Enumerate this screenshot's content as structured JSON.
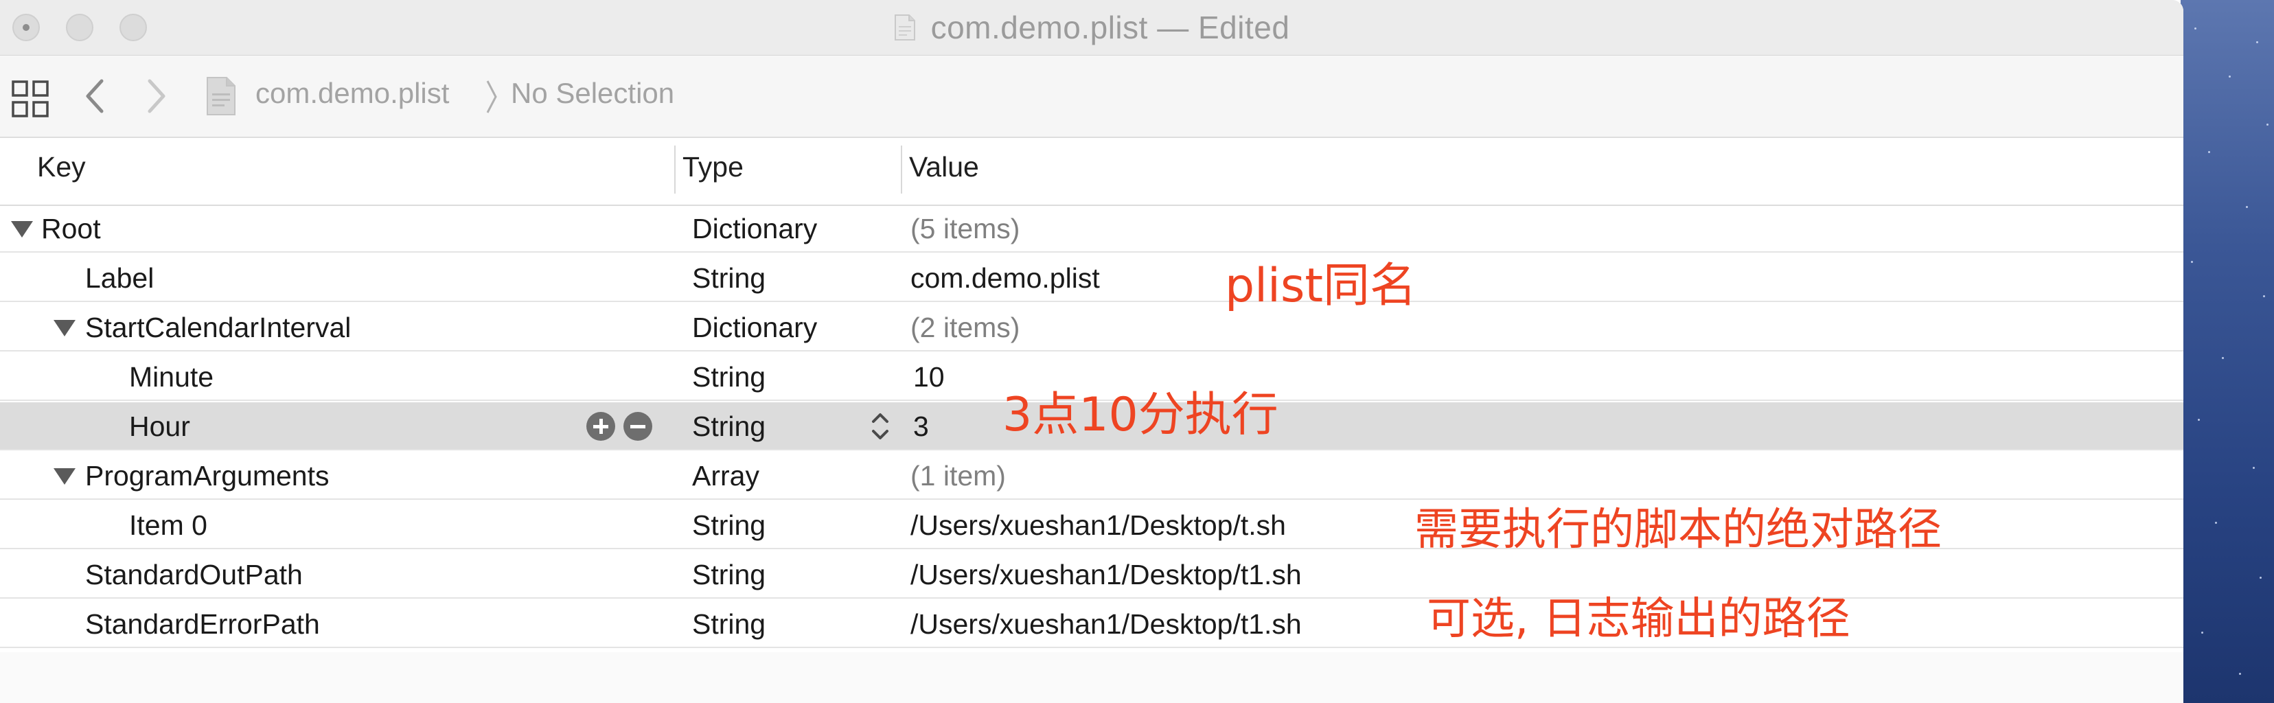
{
  "window": {
    "title": "com.demo.plist — Edited"
  },
  "path_bar": {
    "file": "com.demo.plist",
    "selection": "No Selection"
  },
  "columns": {
    "key": "Key",
    "type": "Type",
    "value": "Value"
  },
  "rows": [
    {
      "key": "Root",
      "type": "Dictionary",
      "value": "(5 items)",
      "level": 0,
      "expandable": true,
      "value_dim": true
    },
    {
      "key": "Label",
      "type": "String",
      "value": "com.demo.plist",
      "level": 1,
      "expandable": false,
      "value_dim": false
    },
    {
      "key": "StartCalendarInterval",
      "type": "Dictionary",
      "value": "(2 items)",
      "level": 1,
      "expandable": true,
      "value_dim": true
    },
    {
      "key": "Minute",
      "type": "String",
      "value": "10",
      "level": 2,
      "expandable": false,
      "value_dim": false
    },
    {
      "key": "Hour",
      "type": "String",
      "value": "3",
      "level": 2,
      "expandable": false,
      "value_dim": false,
      "selected": true
    },
    {
      "key": "ProgramArguments",
      "type": "Array",
      "value": "(1 item)",
      "level": 1,
      "expandable": true,
      "value_dim": true
    },
    {
      "key": "Item 0",
      "type": "String",
      "value": "/Users/xueshan1/Desktop/t.sh",
      "level": 2,
      "expandable": false,
      "value_dim": false
    },
    {
      "key": "StandardOutPath",
      "type": "String",
      "value": "/Users/xueshan1/Desktop/t1.sh",
      "level": 1,
      "expandable": false,
      "value_dim": false
    },
    {
      "key": "StandardErrorPath",
      "type": "String",
      "value": "/Users/xueshan1/Desktop/t1.sh",
      "level": 1,
      "expandable": false,
      "value_dim": false
    }
  ],
  "annotations": {
    "label_note": "plist同名",
    "time_note": "3点10分执行",
    "script_note": "需要执行的脚本的绝对路径",
    "log_note": "可选, 日志输出的路径"
  },
  "colors": {
    "annotation": "#ee4422",
    "selected_row": "#dcdcdc"
  },
  "icons": [
    "grid-view-icon",
    "back-chevron-icon",
    "forward-chevron-icon",
    "plist-document-icon",
    "path-separator-icon",
    "disclosure-triangle-icon",
    "add-row-icon",
    "remove-row-icon",
    "type-stepper-icon"
  ]
}
